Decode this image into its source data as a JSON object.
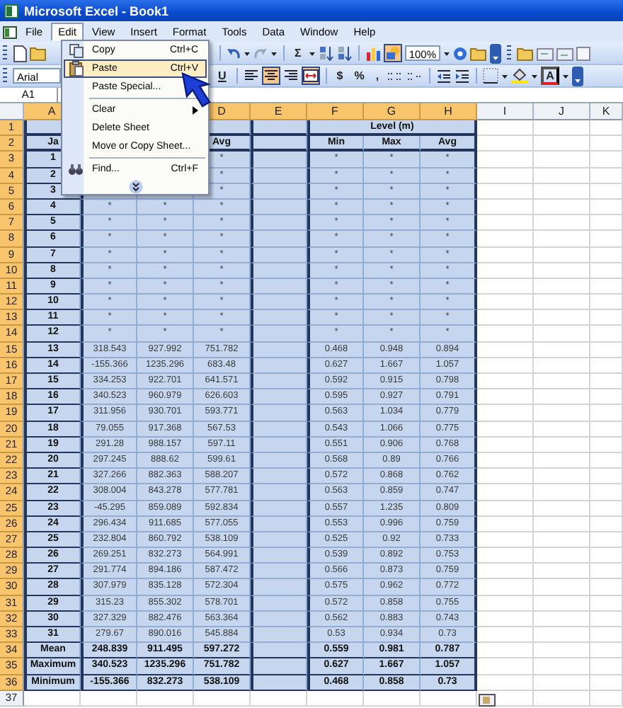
{
  "window": {
    "title": "Microsoft Excel - Book1"
  },
  "menu_bar": [
    {
      "label": "File",
      "selected": false
    },
    {
      "label": "Edit",
      "selected": true
    },
    {
      "label": "View",
      "selected": false
    },
    {
      "label": "Insert",
      "selected": false
    },
    {
      "label": "Format",
      "selected": false
    },
    {
      "label": "Tools",
      "selected": false
    },
    {
      "label": "Data",
      "selected": false
    },
    {
      "label": "Window",
      "selected": false
    },
    {
      "label": "Help",
      "selected": false
    }
  ],
  "standard_toolbar": {
    "sum_symbol": "Σ",
    "zoom": "100%",
    "drawing_pressed": true
  },
  "formatting_toolbar": {
    "font": "Arial",
    "underline": "U",
    "currency": "$",
    "percent": "%",
    "comma": ",",
    "font_color_letter": "A",
    "center_pressed": true,
    "merge_pressed": true
  },
  "name_box": "A1",
  "edit_menu": [
    {
      "kind": "item",
      "label": "Copy",
      "shortcut": "Ctrl+C",
      "selected": false
    },
    {
      "kind": "item",
      "label": "Paste",
      "shortcut": "Ctrl+V",
      "selected": true
    },
    {
      "kind": "item",
      "label": "Paste Special...",
      "selected": false
    },
    {
      "kind": "separator"
    },
    {
      "kind": "submenu",
      "label": "Clear",
      "selected": false
    },
    {
      "kind": "item",
      "label": "Delete Sheet",
      "selected": false
    },
    {
      "kind": "item",
      "label": "Move or Copy Sheet...",
      "selected": false
    },
    {
      "kind": "separator"
    },
    {
      "kind": "item",
      "label": "Find...",
      "shortcut": "Ctrl+F",
      "selected": false
    },
    {
      "kind": "expand"
    }
  ],
  "columns": [
    {
      "label": "A",
      "selected": true
    },
    {
      "label": "D",
      "selected": true
    },
    {
      "label": "E",
      "selected": true
    },
    {
      "label": "F",
      "selected": true
    },
    {
      "label": "G",
      "selected": true
    },
    {
      "label": "H",
      "selected": true
    },
    {
      "label": "I",
      "selected": false
    },
    {
      "label": "J",
      "selected": false
    },
    {
      "label": "K",
      "selected": false
    }
  ],
  "rows": [
    {
      "number": "1",
      "selected": true,
      "kind": "group_header",
      "cells": {
        "f": "Level (m)"
      }
    },
    {
      "number": "2",
      "selected": true,
      "kind": "header",
      "cells": {
        "a": "Ja",
        "d": "Avg",
        "f": "Min",
        "g": "Max",
        "h": "Avg"
      }
    },
    {
      "number": "3",
      "selected": true,
      "kind": "data",
      "cells": {
        "a": "1",
        "d": "*",
        "f": "*",
        "g": "*",
        "h": "*"
      }
    },
    {
      "number": "4",
      "selected": true,
      "kind": "data",
      "cells": {
        "a": "2",
        "d": "*",
        "f": "*",
        "g": "*",
        "h": "*"
      }
    },
    {
      "number": "5",
      "selected": true,
      "kind": "data",
      "cells": {
        "a": "3",
        "d": "*",
        "f": "*",
        "g": "*",
        "h": "*"
      }
    },
    {
      "number": "6",
      "selected": true,
      "kind": "data",
      "cells": {
        "a": "4",
        "b": "*",
        "c": "*",
        "d": "*",
        "f": "*",
        "g": "*",
        "h": "*"
      }
    },
    {
      "number": "7",
      "selected": true,
      "kind": "data",
      "cells": {
        "a": "5",
        "b": "*",
        "c": "*",
        "d": "*",
        "f": "*",
        "g": "*",
        "h": "*"
      }
    },
    {
      "number": "8",
      "selected": true,
      "kind": "data",
      "cells": {
        "a": "6",
        "b": "*",
        "c": "*",
        "d": "*",
        "f": "*",
        "g": "*",
        "h": "*"
      }
    },
    {
      "number": "9",
      "selected": true,
      "kind": "data",
      "cells": {
        "a": "7",
        "b": "*",
        "c": "*",
        "d": "*",
        "f": "*",
        "g": "*",
        "h": "*"
      }
    },
    {
      "number": "10",
      "selected": true,
      "kind": "data",
      "cells": {
        "a": "8",
        "b": "*",
        "c": "*",
        "d": "*",
        "f": "*",
        "g": "*",
        "h": "*"
      }
    },
    {
      "number": "11",
      "selected": true,
      "kind": "data",
      "cells": {
        "a": "9",
        "b": "*",
        "c": "*",
        "d": "*",
        "f": "*",
        "g": "*",
        "h": "*"
      }
    },
    {
      "number": "12",
      "selected": true,
      "kind": "data",
      "cells": {
        "a": "10",
        "b": "*",
        "c": "*",
        "d": "*",
        "f": "*",
        "g": "*",
        "h": "*"
      }
    },
    {
      "number": "13",
      "selected": true,
      "kind": "data",
      "cells": {
        "a": "11",
        "b": "*",
        "c": "*",
        "d": "*",
        "f": "*",
        "g": "*",
        "h": "*"
      }
    },
    {
      "number": "14",
      "selected": true,
      "kind": "data",
      "cells": {
        "a": "12",
        "b": "*",
        "c": "*",
        "d": "*",
        "f": "*",
        "g": "*",
        "h": "*"
      }
    },
    {
      "number": "15",
      "selected": true,
      "kind": "data",
      "cells": {
        "a": "13",
        "b": "318.543",
        "c": "927.992",
        "d": "751.782",
        "f": "0.468",
        "g": "0.948",
        "h": "0.894"
      }
    },
    {
      "number": "16",
      "selected": true,
      "kind": "data",
      "cells": {
        "a": "14",
        "b": "-155.366",
        "c": "1235.296",
        "d": "683.48",
        "f": "0.627",
        "g": "1.667",
        "h": "1.057"
      }
    },
    {
      "number": "17",
      "selected": true,
      "kind": "data",
      "cells": {
        "a": "15",
        "b": "334.253",
        "c": "922.701",
        "d": "641.571",
        "f": "0.592",
        "g": "0.915",
        "h": "0.798"
      }
    },
    {
      "number": "18",
      "selected": true,
      "kind": "data",
      "cells": {
        "a": "16",
        "b": "340.523",
        "c": "960.979",
        "d": "626.603",
        "f": "0.595",
        "g": "0.927",
        "h": "0.791"
      }
    },
    {
      "number": "19",
      "selected": true,
      "kind": "data",
      "cells": {
        "a": "17",
        "b": "311.956",
        "c": "930.701",
        "d": "593.771",
        "f": "0.563",
        "g": "1.034",
        "h": "0.779"
      }
    },
    {
      "number": "20",
      "selected": true,
      "kind": "data",
      "cells": {
        "a": "18",
        "b": "79.055",
        "c": "917.368",
        "d": "567.53",
        "f": "0.543",
        "g": "1.066",
        "h": "0.775"
      }
    },
    {
      "number": "21",
      "selected": true,
      "kind": "data",
      "cells": {
        "a": "19",
        "b": "291.28",
        "c": "988.157",
        "d": "597.11",
        "f": "0.551",
        "g": "0.906",
        "h": "0.768"
      }
    },
    {
      "number": "22",
      "selected": true,
      "kind": "data",
      "cells": {
        "a": "20",
        "b": "297.245",
        "c": "888.62",
        "d": "599.61",
        "f": "0.568",
        "g": "0.89",
        "h": "0.766"
      }
    },
    {
      "number": "23",
      "selected": true,
      "kind": "data",
      "cells": {
        "a": "21",
        "b": "327.266",
        "c": "882.363",
        "d": "588.207",
        "f": "0.572",
        "g": "0.868",
        "h": "0.762"
      }
    },
    {
      "number": "24",
      "selected": true,
      "kind": "data",
      "cells": {
        "a": "22",
        "b": "308.004",
        "c": "843.278",
        "d": "577.781",
        "f": "0.563",
        "g": "0.859",
        "h": "0.747"
      }
    },
    {
      "number": "25",
      "selected": true,
      "kind": "data",
      "cells": {
        "a": "23",
        "b": "-45.295",
        "c": "859.089",
        "d": "592.834",
        "f": "0.557",
        "g": "1.235",
        "h": "0.809"
      }
    },
    {
      "number": "26",
      "selected": true,
      "kind": "data",
      "cells": {
        "a": "24",
        "b": "296.434",
        "c": "911.685",
        "d": "577.055",
        "f": "0.553",
        "g": "0.996",
        "h": "0.759"
      }
    },
    {
      "number": "27",
      "selected": true,
      "kind": "data",
      "cells": {
        "a": "25",
        "b": "232.804",
        "c": "860.792",
        "d": "538.109",
        "f": "0.525",
        "g": "0.92",
        "h": "0.733"
      }
    },
    {
      "number": "28",
      "selected": true,
      "kind": "data",
      "cells": {
        "a": "26",
        "b": "269.251",
        "c": "832.273",
        "d": "564.991",
        "f": "0.539",
        "g": "0.892",
        "h": "0.753"
      }
    },
    {
      "number": "29",
      "selected": true,
      "kind": "data",
      "cells": {
        "a": "27",
        "b": "291.774",
        "c": "894.186",
        "d": "587.472",
        "f": "0.566",
        "g": "0.873",
        "h": "0.759"
      }
    },
    {
      "number": "30",
      "selected": true,
      "kind": "data",
      "cells": {
        "a": "28",
        "b": "307.979",
        "c": "835.128",
        "d": "572.304",
        "f": "0.575",
        "g": "0.962",
        "h": "0.772"
      }
    },
    {
      "number": "31",
      "selected": true,
      "kind": "data",
      "cells": {
        "a": "29",
        "b": "315.23",
        "c": "855.302",
        "d": "578.701",
        "f": "0.572",
        "g": "0.858",
        "h": "0.755"
      }
    },
    {
      "number": "32",
      "selected": true,
      "kind": "data",
      "cells": {
        "a": "30",
        "b": "327.329",
        "c": "882.476",
        "d": "563.364",
        "f": "0.562",
        "g": "0.883",
        "h": "0.743"
      }
    },
    {
      "number": "33",
      "selected": true,
      "kind": "data",
      "cells": {
        "a": "31",
        "b": "279.67",
        "c": "890.016",
        "d": "545.884",
        "f": "0.53",
        "g": "0.934",
        "h": "0.73"
      }
    },
    {
      "number": "34",
      "selected": true,
      "kind": "summary",
      "cells": {
        "a": "Mean",
        "b": "248.839",
        "c": "911.495",
        "d": "597.272",
        "f": "0.559",
        "g": "0.981",
        "h": "0.787"
      }
    },
    {
      "number": "35",
      "selected": true,
      "kind": "summary",
      "cells": {
        "a": "Maximum",
        "b": "340.523",
        "c": "1235.296",
        "d": "751.782",
        "f": "0.627",
        "g": "1.667",
        "h": "1.057"
      }
    },
    {
      "number": "36",
      "selected": true,
      "kind": "summary",
      "cells": {
        "a": "Minimum",
        "b": "-155.366",
        "c": "832.273",
        "d": "538.109",
        "f": "0.468",
        "g": "0.858",
        "h": "0.73"
      }
    },
    {
      "number": "37",
      "selected": false,
      "kind": "data"
    }
  ]
}
